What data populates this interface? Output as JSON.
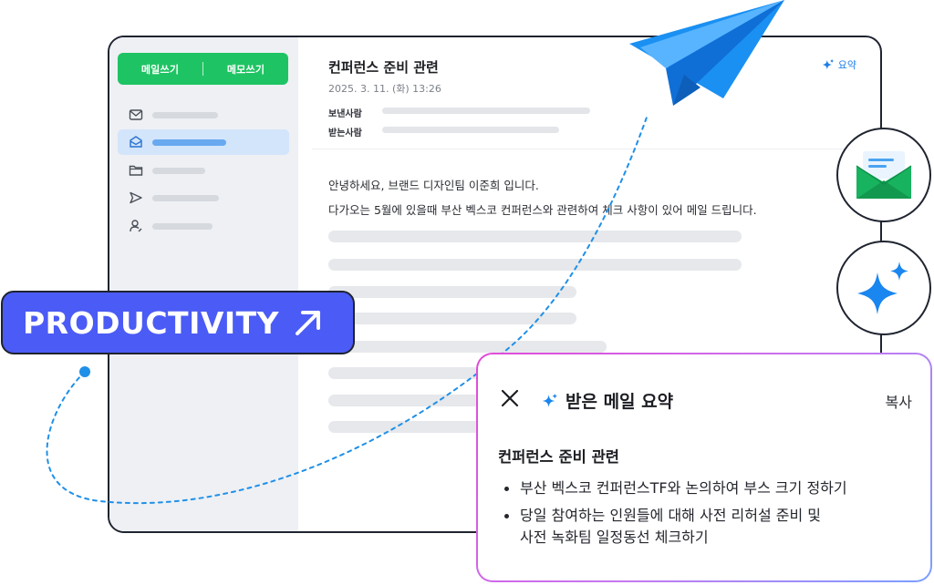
{
  "compose": {
    "write_mail": "메일쓰기",
    "write_memo": "메모쓰기"
  },
  "sidebar": {
    "items": [
      {
        "icon": "mail-icon"
      },
      {
        "icon": "inbox-icon",
        "active": true
      },
      {
        "icon": "folder-icon"
      },
      {
        "icon": "send-icon"
      },
      {
        "icon": "contacts-icon"
      }
    ]
  },
  "mail": {
    "subject": "컨퍼런스 준비 관련",
    "date": "2025. 3. 11. (화) 13:26",
    "summarize_label": "요약",
    "sender_label": "보낸사람",
    "recipient_label": "받는사람",
    "body_line1": "안녕하세요, 브랜드 디자인팀 이준희 입니다.",
    "body_line2": "다가오는 5월에 있을때 부산 벡스코 컨퍼런스와 관련하여 체크 사항이 있어 메일 드립니다."
  },
  "badge": {
    "text": "PRODUCTIVITY"
  },
  "summary": {
    "title": "받은 메일 요약",
    "copy_label": "복사",
    "subject": "컨퍼런스 준비 관련",
    "items": [
      {
        "line1": "부산 벡스코 컨퍼런스TF와 논의하여 부스 크기 정하기",
        "line2": ""
      },
      {
        "line1": "당일 참여하는 인원들에 대해 사전 리허설 준비 및",
        "line2": "사전 녹화팀 일정동선 체크하기"
      }
    ]
  },
  "colors": {
    "accent_green": "#1ec463",
    "accent_blue": "#1e7ee8",
    "badge_purple": "#4b5bf5",
    "sparkle_blue": "#1a86f0"
  }
}
